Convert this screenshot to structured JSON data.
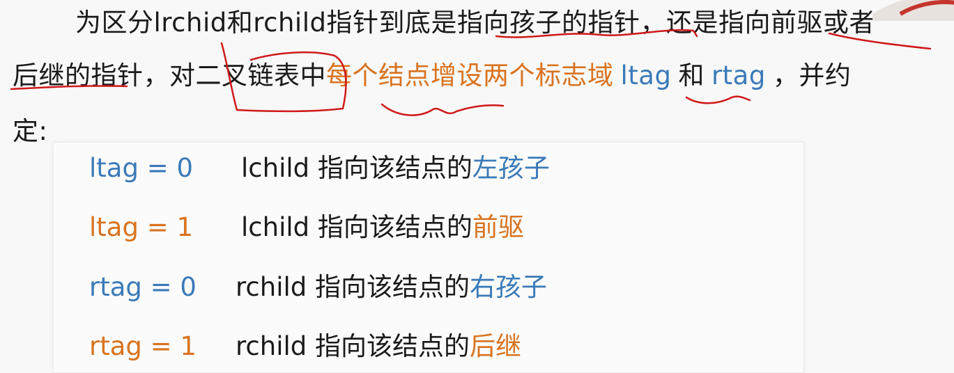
{
  "paragraph": {
    "line1": "为区分lrchid和rchild指针到底是指向孩子的指针，还是指向前驱或者",
    "line2_part1": "后继的指针，对二叉链表中",
    "line2_highlight": "每个结点增设两个标志域",
    "line2_tag1": "ltag",
    "line2_and": "和",
    "line2_tag2": "rtag",
    "line2_end": "，并约",
    "line3": "定:"
  },
  "rules": [
    {
      "tag": "ltag = 0",
      "desc_prefix": "lchild 指向该结点的",
      "desc_suffix": "左孩子",
      "tag_color": "blue",
      "suffix_color": "blue"
    },
    {
      "tag": "ltag = 1",
      "desc_prefix": "lchild 指向该结点的",
      "desc_suffix": "前驱",
      "tag_color": "orange",
      "suffix_color": "orange"
    },
    {
      "tag": "rtag = 0",
      "desc_prefix": "rchild 指向该结点的",
      "desc_suffix": "右孩子",
      "tag_color": "blue",
      "suffix_color": "blue"
    },
    {
      "tag": "rtag = 1",
      "desc_prefix": "rchild 指向该结点的",
      "desc_suffix": "后继",
      "tag_color": "orange",
      "suffix_color": "orange"
    }
  ],
  "colors": {
    "orange": "#d9731f",
    "blue": "#3a7ab8",
    "ink": "#d01818"
  }
}
